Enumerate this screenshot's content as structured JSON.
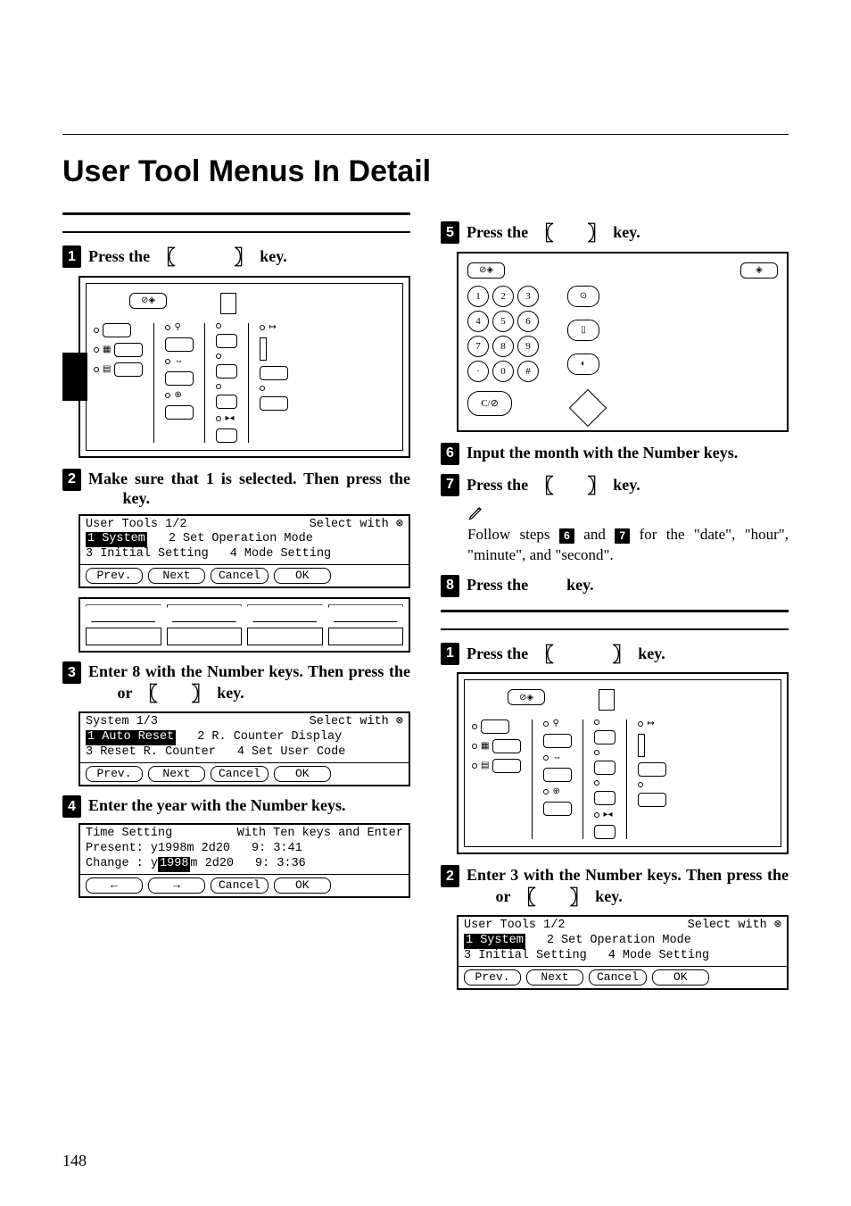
{
  "page_number": "148",
  "title": "User Tool Menus In Detail",
  "left": {
    "step1": "Press the ",
    "step1_tail": " key.",
    "step2_a": "Make sure that 1 is selected. Then press the ",
    "step2_b": " key.",
    "step3_a": "Enter 8 with the Number keys. Then press the ",
    "step3_or": " or ",
    "step3_b": " key.",
    "step4": "Enter the year with the Number keys."
  },
  "right": {
    "step5": "Press the ",
    "step5_tail": " key.",
    "step6": "Input the month with the Number keys.",
    "step7": "Press the ",
    "step7_tail": " key.",
    "note": "Follow steps ",
    "note_mid": " and ",
    "note_tail": " for the \"date\", \"hour\", \"minute\", and \"second\".",
    "note_badge_a": "6",
    "note_badge_b": "7",
    "step8": "Press the ",
    "step8_tail": " key.",
    "b_step1": "Press the ",
    "b_step1_tail": " key.",
    "b_step2_a": "Enter 3 with the Number keys. Then press the ",
    "b_step2_or": " or ",
    "b_step2_b": " key."
  },
  "lcd1": {
    "title": "User Tools 1/2",
    "hint": "Select with ⊗",
    "opt1": "1 System",
    "opt2": "2 Set Operation Mode",
    "opt3": "3 Initial Setting",
    "opt4": "4 Mode Setting",
    "b1": "Prev.",
    "b2": "Next",
    "b3": "Cancel",
    "b4": "OK"
  },
  "lcd2": {
    "title": "System 1/3",
    "hint": "Select with ⊗",
    "opt1": "1 Auto Reset",
    "opt2": "2 R. Counter Display",
    "opt3": "3 Reset R. Counter",
    "opt4": "4 Set User Code",
    "b1": "Prev.",
    "b2": "Next",
    "b3": "Cancel",
    "b4": "OK"
  },
  "lcd3": {
    "title": "Time Setting",
    "hint": "With Ten keys and Enter",
    "line1_a": "Present: y1998m 2d20",
    "line1_b": "9: 3:41",
    "line2_a": "Change : y",
    "line2_sel": "1998",
    "line2_b": "m 2d20",
    "line2_c": "9: 3:36",
    "b1": "←",
    "b2": "→",
    "b3": "Cancel",
    "b4": "OK"
  },
  "lcd4": {
    "title": "User Tools 1/2",
    "hint": "Select with ⊗",
    "opt1": "1 System",
    "opt2": "2 Set Operation Mode",
    "opt3": "3 Initial Setting",
    "opt4": "4 Mode Setting",
    "b1": "Prev.",
    "b2": "Next",
    "b3": "Cancel",
    "b4": "OK"
  },
  "numpad": {
    "k1": "1",
    "k2": "2",
    "k3": "3",
    "k4": "4",
    "k5": "5",
    "k6": "6",
    "k7": "7",
    "k8": "8",
    "k9": "9",
    "k0": "0",
    "kdot": "·",
    "khash": "#",
    "clear": "C/⊘"
  },
  "icons": {
    "tools": "⊘◈",
    "contrast": "◈"
  }
}
